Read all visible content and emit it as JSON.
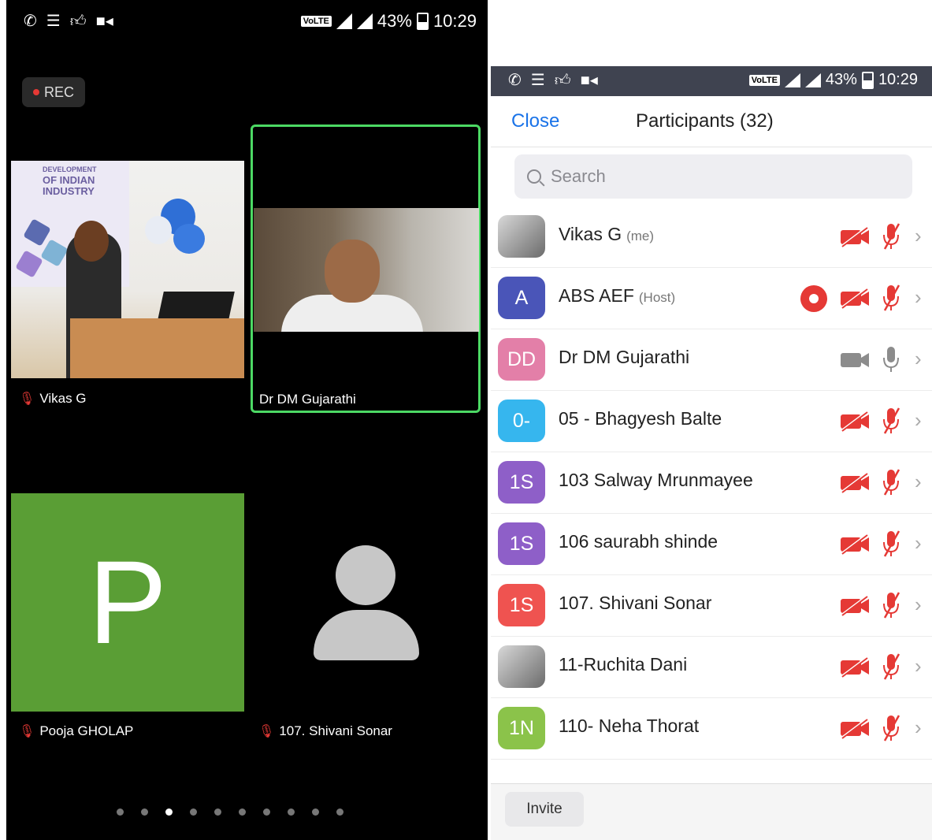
{
  "status_bar": {
    "volte": "VoLTE",
    "battery": "43%",
    "time": "10:29"
  },
  "meeting": {
    "rec_label": "REC",
    "tiles": [
      {
        "name": "Vikas G",
        "muted": true
      },
      {
        "name": "Dr DM Gujarathi",
        "muted": false,
        "active_speaker": true
      },
      {
        "name": "Pooja GHOLAP",
        "muted": true,
        "avatar_letter": "P",
        "color": "#5a9e35"
      },
      {
        "name": "107. Shivani Sonar",
        "muted": true
      }
    ],
    "page_dots": 10,
    "active_dot": 3
  },
  "banner": {
    "line1": "DEVELOPMENT",
    "line2": "OF INDIAN",
    "line3": "INDUSTRY"
  },
  "participants": {
    "close_label": "Close",
    "title": "Participants (32)",
    "search_placeholder": "Search",
    "rows": [
      {
        "initials": "",
        "name": "Vikas G",
        "tag": "(me)",
        "photo": true,
        "video": "off",
        "mic": "muted",
        "recording": false
      },
      {
        "initials": "A",
        "name": "ABS AEF",
        "tag": "(Host)",
        "color": "#4a55b8",
        "video": "off",
        "mic": "muted",
        "recording": true
      },
      {
        "initials": "DD",
        "name": "Dr DM Gujarathi",
        "tag": "",
        "color": "#e37fa8",
        "video": "on",
        "mic": "on",
        "recording": false
      },
      {
        "initials": "0-",
        "name": "05 - Bhagyesh Balte",
        "tag": "",
        "color": "#36b6ee",
        "video": "off",
        "mic": "muted",
        "recording": false
      },
      {
        "initials": "1S",
        "name": "103 Salway Mrunmayee",
        "tag": "",
        "color": "#8e5fc8",
        "video": "off",
        "mic": "muted",
        "recording": false
      },
      {
        "initials": "1S",
        "name": "106 saurabh shinde",
        "tag": "",
        "color": "#8e5fc8",
        "video": "off",
        "mic": "muted",
        "recording": false
      },
      {
        "initials": "1S",
        "name": "107. Shivani Sonar",
        "tag": "",
        "color": "#ef5350",
        "video": "off",
        "mic": "muted",
        "recording": false
      },
      {
        "initials": "",
        "name": "11-Ruchita Dani",
        "tag": "",
        "photo": true,
        "video": "off",
        "mic": "muted",
        "recording": false
      },
      {
        "initials": "1N",
        "name": "110- Neha Thorat",
        "tag": "",
        "color": "#8bc34a",
        "video": "off",
        "mic": "muted",
        "recording": false
      }
    ],
    "invite_label": "Invite"
  },
  "colors": {
    "accent": "#1a73e8",
    "muted_red": "#e53935",
    "active_border": "#4cd964"
  }
}
